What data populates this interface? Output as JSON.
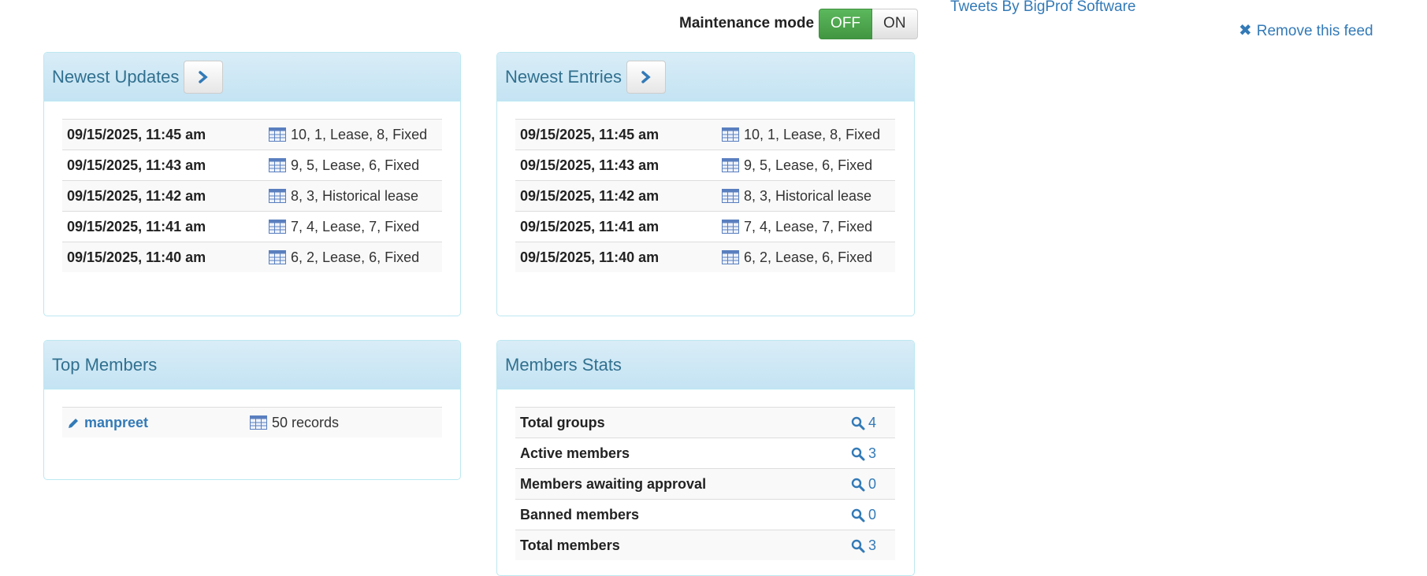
{
  "maintenance": {
    "label": "Maintenance mode",
    "off_label": "OFF",
    "on_label": "ON"
  },
  "twitter": {
    "link_text": "Tweets By BigProf Software",
    "remove_label": "Remove this feed"
  },
  "newest_updates": {
    "title": "Newest Updates",
    "rows": [
      {
        "date": "09/15/2025, 11:45 am",
        "text": "10, 1, Lease, 8, Fixed"
      },
      {
        "date": "09/15/2025, 11:43 am",
        "text": "9, 5, Lease, 6, Fixed"
      },
      {
        "date": "09/15/2025, 11:42 am",
        "text": "8, 3, Historical lease"
      },
      {
        "date": "09/15/2025, 11:41 am",
        "text": "7, 4, Lease, 7, Fixed"
      },
      {
        "date": "09/15/2025, 11:40 am",
        "text": "6, 2, Lease, 6, Fixed"
      }
    ]
  },
  "newest_entries": {
    "title": "Newest Entries",
    "rows": [
      {
        "date": "09/15/2025, 11:45 am",
        "text": "10, 1, Lease, 8, Fixed"
      },
      {
        "date": "09/15/2025, 11:43 am",
        "text": "9, 5, Lease, 6, Fixed"
      },
      {
        "date": "09/15/2025, 11:42 am",
        "text": "8, 3, Historical lease"
      },
      {
        "date": "09/15/2025, 11:41 am",
        "text": "7, 4, Lease, 7, Fixed"
      },
      {
        "date": "09/15/2025, 11:40 am",
        "text": "6, 2, Lease, 6, Fixed"
      }
    ]
  },
  "top_members": {
    "title": "Top Members",
    "rows": [
      {
        "name": "manpreet",
        "records": "50 records"
      }
    ]
  },
  "members_stats": {
    "title": "Members Stats",
    "rows": [
      {
        "label": "Total groups",
        "value": "4"
      },
      {
        "label": "Active members",
        "value": "3"
      },
      {
        "label": "Members awaiting approval",
        "value": "0"
      },
      {
        "label": "Banned members",
        "value": "0"
      },
      {
        "label": "Total members",
        "value": "3"
      }
    ]
  },
  "colors": {
    "accent": "#337ab7",
    "heading_text": "#31708f",
    "toggle_on": "#5cb85c"
  },
  "icons": {
    "panel_button": "chevron-right-icon",
    "entry": "table-icon",
    "member": "pencil-icon",
    "stat": "search-icon",
    "remove": "close-icon"
  }
}
